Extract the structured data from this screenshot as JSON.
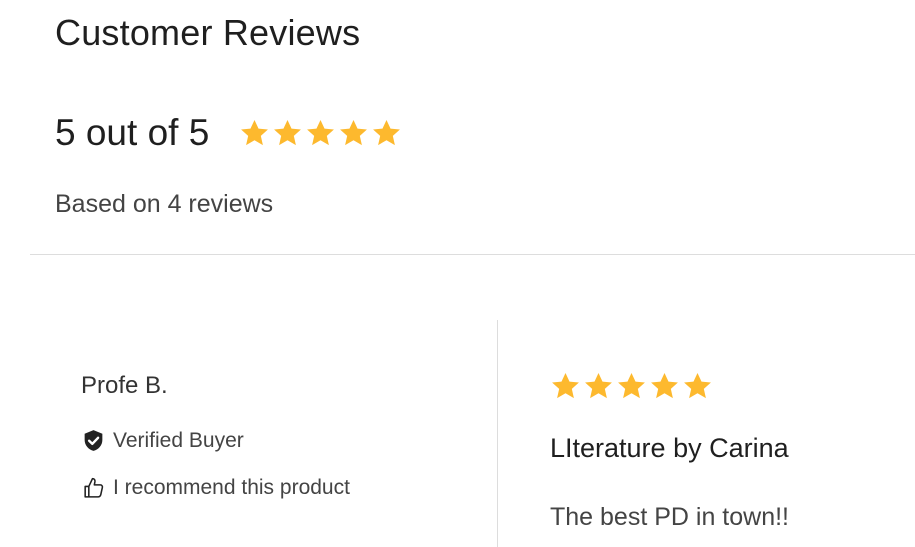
{
  "header": {
    "title": "Customer Reviews"
  },
  "summary": {
    "score_text": "5 out of 5",
    "rating": 5,
    "max_rating": 5,
    "based_on": "Based on 4 reviews"
  },
  "colors": {
    "star": "#FDB92E",
    "divider": "#DDDDDD",
    "text_dark": "#1F1F1F",
    "text_muted": "#444444"
  },
  "reviews": [
    {
      "reviewer": "Profe B.",
      "verified_label": "Verified Buyer",
      "verified_icon": "shield-check-icon",
      "recommend_label": "I recommend this product",
      "recommend_icon": "thumbs-up-icon",
      "rating": 5,
      "title": "LIterature by Carina",
      "body": "The best PD in town!!"
    }
  ]
}
